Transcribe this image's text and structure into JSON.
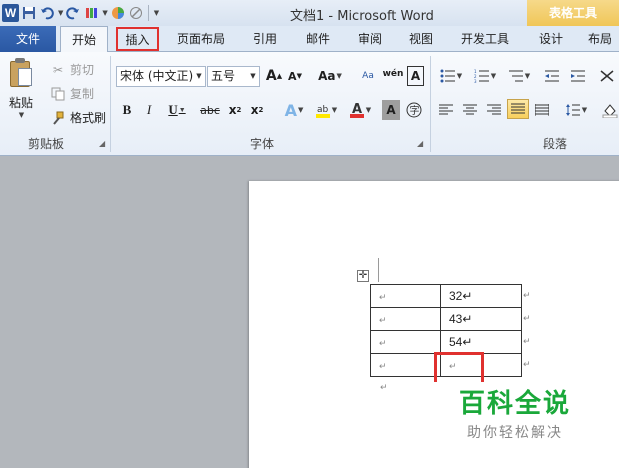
{
  "title_bar": {
    "doc_title": "文档1 - Microsoft Word",
    "context_title": "表格工具",
    "qat": {
      "save": "save-icon",
      "undo": "undo-icon",
      "redo": "redo-icon"
    }
  },
  "tabs": [
    {
      "key": "file",
      "label": "文件"
    },
    {
      "key": "home",
      "label": "开始"
    },
    {
      "key": "insert",
      "label": "插入"
    },
    {
      "key": "page_layout",
      "label": "页面布局"
    },
    {
      "key": "references",
      "label": "引用"
    },
    {
      "key": "mailings",
      "label": "邮件"
    },
    {
      "key": "review",
      "label": "审阅"
    },
    {
      "key": "view",
      "label": "视图"
    },
    {
      "key": "developer",
      "label": "开发工具"
    },
    {
      "key": "design",
      "label": "设计"
    },
    {
      "key": "layout",
      "label": "布局"
    }
  ],
  "ribbon": {
    "clipboard": {
      "paste": "粘贴",
      "cut": "剪切",
      "copy": "复制",
      "format_painter": "格式刷",
      "group_label": "剪贴板"
    },
    "font": {
      "font_name": "宋体 (中文正)",
      "font_size": "五号",
      "change_case": "Aa",
      "group_label": "字体"
    },
    "paragraph": {
      "group_label": "段落"
    }
  },
  "document": {
    "table": [
      [
        "↵",
        "32↵"
      ],
      [
        "↵",
        "43↵"
      ],
      [
        "↵",
        "54↵"
      ],
      [
        "↵",
        "↵"
      ]
    ],
    "row_end_mark": "↵",
    "after_table_mark": "↵"
  },
  "watermark": {
    "title": "百科全说",
    "subtitle": "助你轻松解决"
  },
  "colors": {
    "file_tab": "#2a58a3",
    "highlight_box": "#e0312f",
    "context_tab": "#f0c657",
    "watermark": "#1aa83a"
  }
}
